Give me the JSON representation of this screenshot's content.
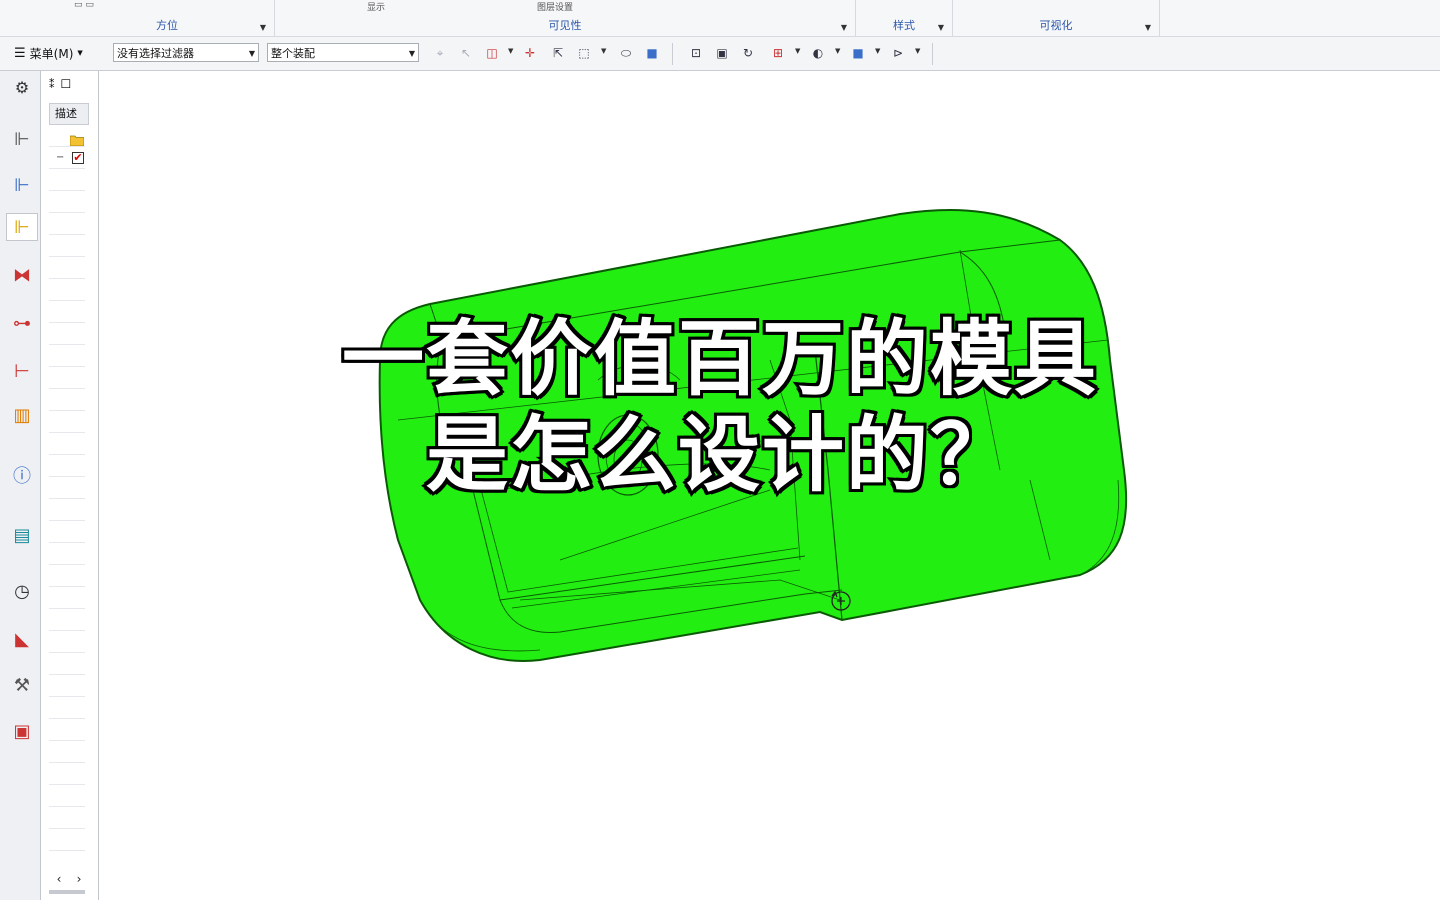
{
  "ribbon": {
    "groups": [
      {
        "label": "方位"
      },
      {
        "label": "可见性"
      },
      {
        "label": "样式"
      },
      {
        "label": "可视化"
      }
    ],
    "stubs": {
      "display": "显示",
      "layer_settings": "图层设置"
    }
  },
  "toolbar": {
    "menu_label": "菜单(M)",
    "filter_combo": "没有选择过滤器",
    "scope_combo": "整个装配"
  },
  "navigator": {
    "column_header": "描述"
  },
  "caption": {
    "line1": "一套价值百万的模具",
    "line2": "是怎么设计的？"
  },
  "colors": {
    "model_green": "#22ee11",
    "model_edge": "#0a5a05",
    "ribbon_label": "#2b56a8"
  }
}
